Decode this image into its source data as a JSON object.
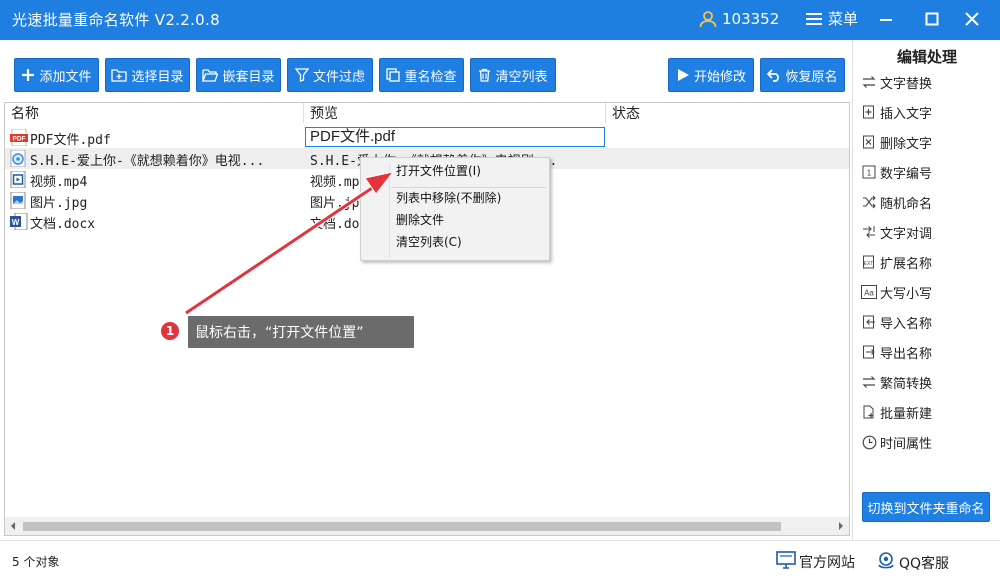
{
  "titlebar": {
    "app_title": "光速批量重命名软件 V2.2.0.8",
    "user_id": "103352",
    "menu_label": "菜单",
    "user_icon": "user-icon",
    "menu_icon": "hamburger-icon"
  },
  "toolbar": {
    "buttons": [
      {
        "label": "添加文件",
        "icon": "plus-icon"
      },
      {
        "label": "选择目录",
        "icon": "folder-add-icon"
      },
      {
        "label": "嵌套目录",
        "icon": "folder-open-icon"
      },
      {
        "label": "文件过虑",
        "icon": "funnel-icon"
      },
      {
        "label": "重名检查",
        "icon": "duplicate-check-icon"
      },
      {
        "label": "清空列表",
        "icon": "trash-icon"
      },
      {
        "label": "开始修改",
        "icon": "play-icon"
      },
      {
        "label": "恢复原名",
        "icon": "undo-icon"
      }
    ]
  },
  "file_list": {
    "columns": [
      "名称",
      "预览",
      "状态"
    ],
    "rows": [
      {
        "name": "PDF文件.pdf",
        "preview": "PDF文件.pdf",
        "status": "",
        "icon": "pdf-file-icon"
      },
      {
        "name": "S.H.E-爱上你-《就想赖着你》电视...",
        "preview": "S.H.E-爱上你-《就想赖着你》电视剧...",
        "status": "",
        "icon": "audio-file-icon"
      },
      {
        "name": "视频.mp4",
        "preview": "视频.mp4",
        "status": "",
        "icon": "video-file-icon"
      },
      {
        "name": "图片.jpg",
        "preview": "图片.jpg",
        "status": "",
        "icon": "image-file-icon"
      },
      {
        "name": "文档.docx",
        "preview": "文档.docx",
        "status": "",
        "icon": "word-file-icon"
      }
    ]
  },
  "context_menu": {
    "items": [
      "打开文件位置(I)",
      "列表中移除(不删除)",
      "删除文件",
      "清空列表(C)"
    ]
  },
  "side_panel": {
    "title": "编辑处理",
    "items": [
      {
        "label": "文字替换",
        "icon": "swap-icon"
      },
      {
        "label": "插入文字",
        "icon": "insert-icon"
      },
      {
        "label": "删除文字",
        "icon": "delete-text-icon"
      },
      {
        "label": "数字编号",
        "icon": "number-icon"
      },
      {
        "label": "随机命名",
        "icon": "shuffle-icon"
      },
      {
        "label": "文字对调",
        "icon": "exchange-icon"
      },
      {
        "label": "扩展名称",
        "icon": "extension-icon"
      },
      {
        "label": "大写小写",
        "icon": "case-icon"
      },
      {
        "label": "导入名称",
        "icon": "import-icon"
      },
      {
        "label": "导出名称",
        "icon": "export-icon"
      },
      {
        "label": "繁简转换",
        "icon": "convert-icon"
      },
      {
        "label": "批量新建",
        "icon": "new-file-icon"
      },
      {
        "label": "时间属性",
        "icon": "clock-icon"
      }
    ],
    "switch_button": "切换到文件夹重命名"
  },
  "statusbar": {
    "object_count": "5 个对象",
    "website_label": "官方网站",
    "qq_label": "QQ客服"
  },
  "annotation": {
    "step_number": "1",
    "text": "鼠标右击，“打开文件位置”"
  },
  "colors": {
    "accent": "#1e7fe0",
    "annotation_red": "#e3343d",
    "annotation_box": "#6b6b6b"
  }
}
